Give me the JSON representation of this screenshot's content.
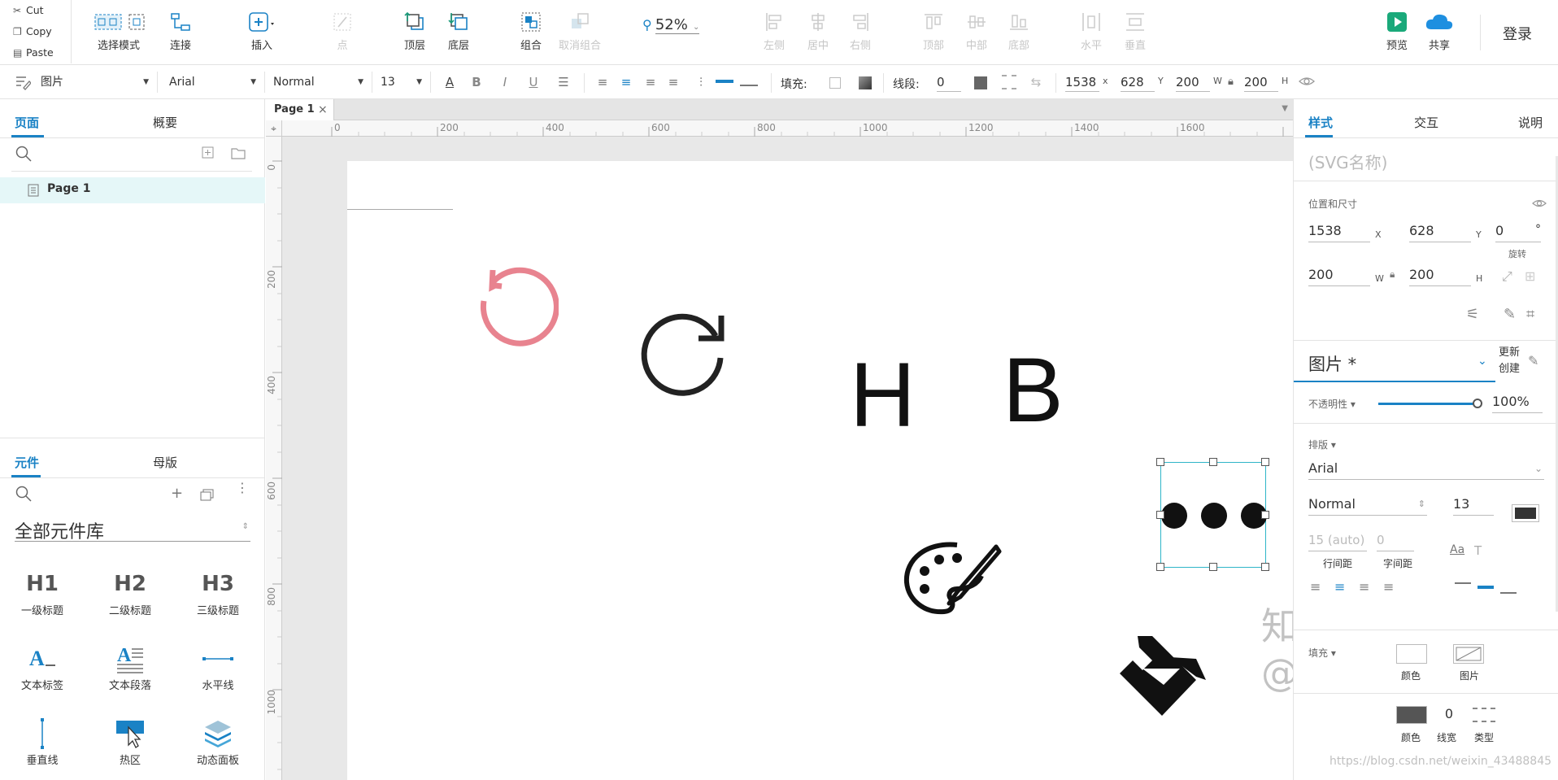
{
  "clipboard": {
    "cut": "Cut",
    "copy": "Copy",
    "paste": "Paste"
  },
  "toolbar": {
    "select_mode": "选择模式",
    "connect": "连接",
    "insert": "插入",
    "point": "点",
    "front": "顶层",
    "back": "底层",
    "group": "组合",
    "ungroup": "取消组合",
    "zoom": "52%",
    "align_left": "左侧",
    "align_center": "居中",
    "align_right": "右侧",
    "align_top": "顶部",
    "align_middle": "中部",
    "align_bottom": "底部",
    "dist_horizontal": "水平",
    "dist_vertical": "垂直",
    "preview": "预览",
    "share": "共享",
    "login": "登录"
  },
  "format": {
    "style": "图片",
    "font": "Arial",
    "weight": "Normal",
    "size": "13",
    "fill_label": "填充:",
    "stroke_label": "线段:",
    "stroke_value": "0",
    "x": "1538",
    "x_unit": "x",
    "y": "628",
    "y_unit": "Y",
    "w": "200",
    "w_unit": "W",
    "h": "200",
    "h_unit": "H"
  },
  "left": {
    "tab_pages": "页面",
    "tab_outline": "概要",
    "page_item": "Page 1",
    "tab_widgets": "元件",
    "tab_masters": "母版",
    "library_name": "全部元件库",
    "widgets": [
      {
        "icon": "H1",
        "label": "一级标题"
      },
      {
        "icon": "H2",
        "label": "二级标题"
      },
      {
        "icon": "H3",
        "label": "三级标题"
      },
      {
        "icon": "A_",
        "label": "文本标签"
      },
      {
        "icon": "A≡",
        "label": "文本段落"
      },
      {
        "icon": "—",
        "label": "水平线"
      },
      {
        "icon": "|",
        "label": "垂直线"
      },
      {
        "icon": "hot",
        "label": "热区"
      },
      {
        "icon": "layers",
        "label": "动态面板"
      }
    ]
  },
  "canvas": {
    "tab": "Page 1",
    "h_ruler": [
      "0",
      "200",
      "400",
      "600",
      "800",
      "1000",
      "1200",
      "1400",
      "1600"
    ],
    "v_ruler": [
      "0",
      "200",
      "400",
      "600",
      "800",
      "1000"
    ],
    "letter_h": "H",
    "letter_b": "B",
    "icons": [
      "undo-icon",
      "refresh-icon",
      "palette-icon",
      "ellipsis-icon",
      "paint-bucket-icon"
    ]
  },
  "right": {
    "tab_style": "样式",
    "tab_interaction": "交互",
    "tab_notes": "说明",
    "name_placeholder": "(SVG名称)",
    "pos_size": "位置和尺寸",
    "x": "1538",
    "x_unit": "X",
    "y": "628",
    "y_unit": "Y",
    "rotation": "0",
    "rotation_unit": "°",
    "rotation_label": "旋转",
    "w": "200",
    "w_unit": "W",
    "h": "200",
    "h_unit": "H",
    "style_name": "图片 *",
    "update": "更新",
    "create": "创建",
    "opacity_label": "不透明性 ▾",
    "opacity": "100%",
    "opacity_fraction": 1.0,
    "typography": "排版 ▾",
    "font": "Arial",
    "weight": "Normal",
    "size": "13",
    "text_color": "#333333",
    "line_height": "15 (auto)",
    "line_height_label": "行间距",
    "letter_spacing": "0",
    "letter_spacing_label": "字间距",
    "fill_label": "填充 ▾",
    "fill_color": "颜色",
    "fill_image": "图片",
    "stroke_color": "颜色",
    "stroke_width": "0",
    "stroke_width_label": "线宽",
    "stroke_type": "类型"
  },
  "watermark": {
    "zhihu": "知乎 @gogo",
    "csdn": "https://blog.csdn.net/weixin_43488845"
  },
  "colors": {
    "accent": "#1a82c5",
    "undo_icon": "#e8838f",
    "selection": "#2fb5c8",
    "preview_green": "#1aa97a",
    "share_blue": "#1e8fe0",
    "page_tab_sel": "#e5f7f8"
  }
}
